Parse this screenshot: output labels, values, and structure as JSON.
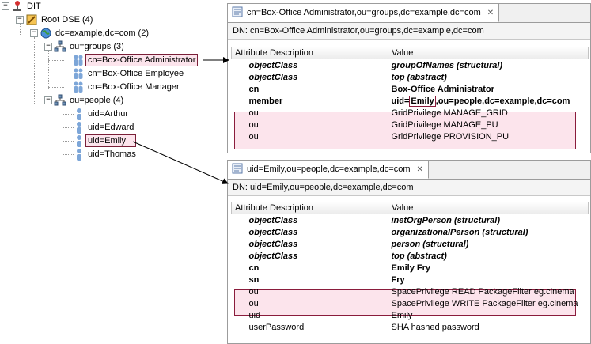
{
  "tree": {
    "dit": "DIT",
    "root_dse": "Root DSE (4)",
    "base": "dc=example,dc=com (2)",
    "groups": "ou=groups (3)",
    "group_items": [
      "cn=Box-Office Administrator",
      "cn=Box-Office Employee",
      "cn=Box-Office Manager"
    ],
    "people": "ou=people (4)",
    "people_items": [
      "uid=Arthur",
      "uid=Edward",
      "uid=Emily",
      "uid=Thomas"
    ]
  },
  "panel1": {
    "tab_title": "cn=Box-Office Administrator,ou=groups,dc=example,dc=com",
    "dn": "DN: cn=Box-Office Administrator,ou=groups,dc=example,dc=com",
    "headers": [
      "Attribute Description",
      "Value"
    ],
    "rows": [
      {
        "attr": "objectClass",
        "value": "groupOfNames (structural)"
      },
      {
        "attr": "objectClass",
        "value": "top (abstract)"
      },
      {
        "attr": "cn",
        "value": "Box-Office Administrator"
      },
      {
        "attr": "member",
        "value_prefix": "uid=",
        "value_hl": "Emily",
        "value_suffix": ",ou=people,dc=example,dc=com"
      },
      {
        "attr": "ou",
        "value": "GridPrivilege MANAGE_GRID"
      },
      {
        "attr": "ou",
        "value": "GridPrivilege MANAGE_PU"
      },
      {
        "attr": "ou",
        "value": "GridPrivilege PROVISION_PU"
      }
    ]
  },
  "panel2": {
    "tab_title": "uid=Emily,ou=people,dc=example,dc=com",
    "dn": "DN: uid=Emily,ou=people,dc=example,dc=com",
    "headers": [
      "Attribute Description",
      "Value"
    ],
    "rows": [
      {
        "attr": "objectClass",
        "value": "inetOrgPerson (structural)"
      },
      {
        "attr": "objectClass",
        "value": "organizationalPerson (structural)"
      },
      {
        "attr": "objectClass",
        "value": "person (structural)"
      },
      {
        "attr": "objectClass",
        "value": "top (abstract)"
      },
      {
        "attr": "cn",
        "value": "Emily Fry"
      },
      {
        "attr": "sn",
        "value": "Fry"
      },
      {
        "attr": "ou",
        "value": "SpacePrivilege READ PackageFilter eg.cinema"
      },
      {
        "attr": "ou",
        "value": "SpacePrivilege WRITE PackageFilter eg.cinema"
      },
      {
        "attr": "uid",
        "value": "Emily"
      },
      {
        "attr": "userPassword",
        "value": "SHA hashed password"
      }
    ]
  },
  "colors": {
    "highlight_border": "#8a1c3c",
    "highlight_fill": "#fce4ec"
  }
}
